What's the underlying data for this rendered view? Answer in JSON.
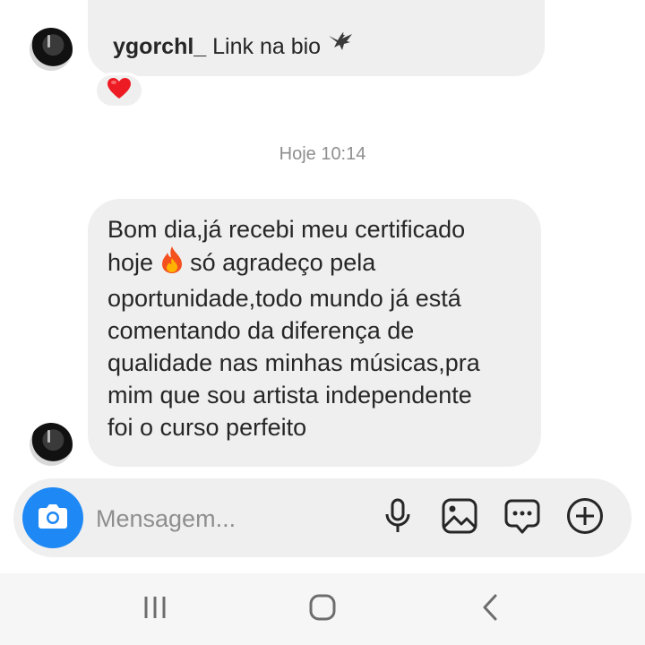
{
  "thread": {
    "reply_preview": {
      "username": "ygorchl_",
      "text": "Link na bio",
      "emoji": "eagle-icon"
    },
    "reaction": "heart-icon",
    "timestamp": "Hoje 10:14",
    "message": {
      "line1": "Bom dia,já recebi meu certificado",
      "line2_before": "hoje",
      "line2_after": "só agradeço pela",
      "line3": "oportunidade,todo mundo já está",
      "line4": "comentando da diferença de",
      "line5": "qualidade nas minhas músicas,pra",
      "line6": "mim que sou artista independente",
      "line7": "foi o curso perfeito"
    }
  },
  "composer": {
    "placeholder": "Mensagem...",
    "accent": "#1e88f5"
  },
  "colors": {
    "bubble": "#efefef",
    "text": "#262626",
    "muted": "#8e8e8e",
    "reaction": "#ed1c24"
  }
}
